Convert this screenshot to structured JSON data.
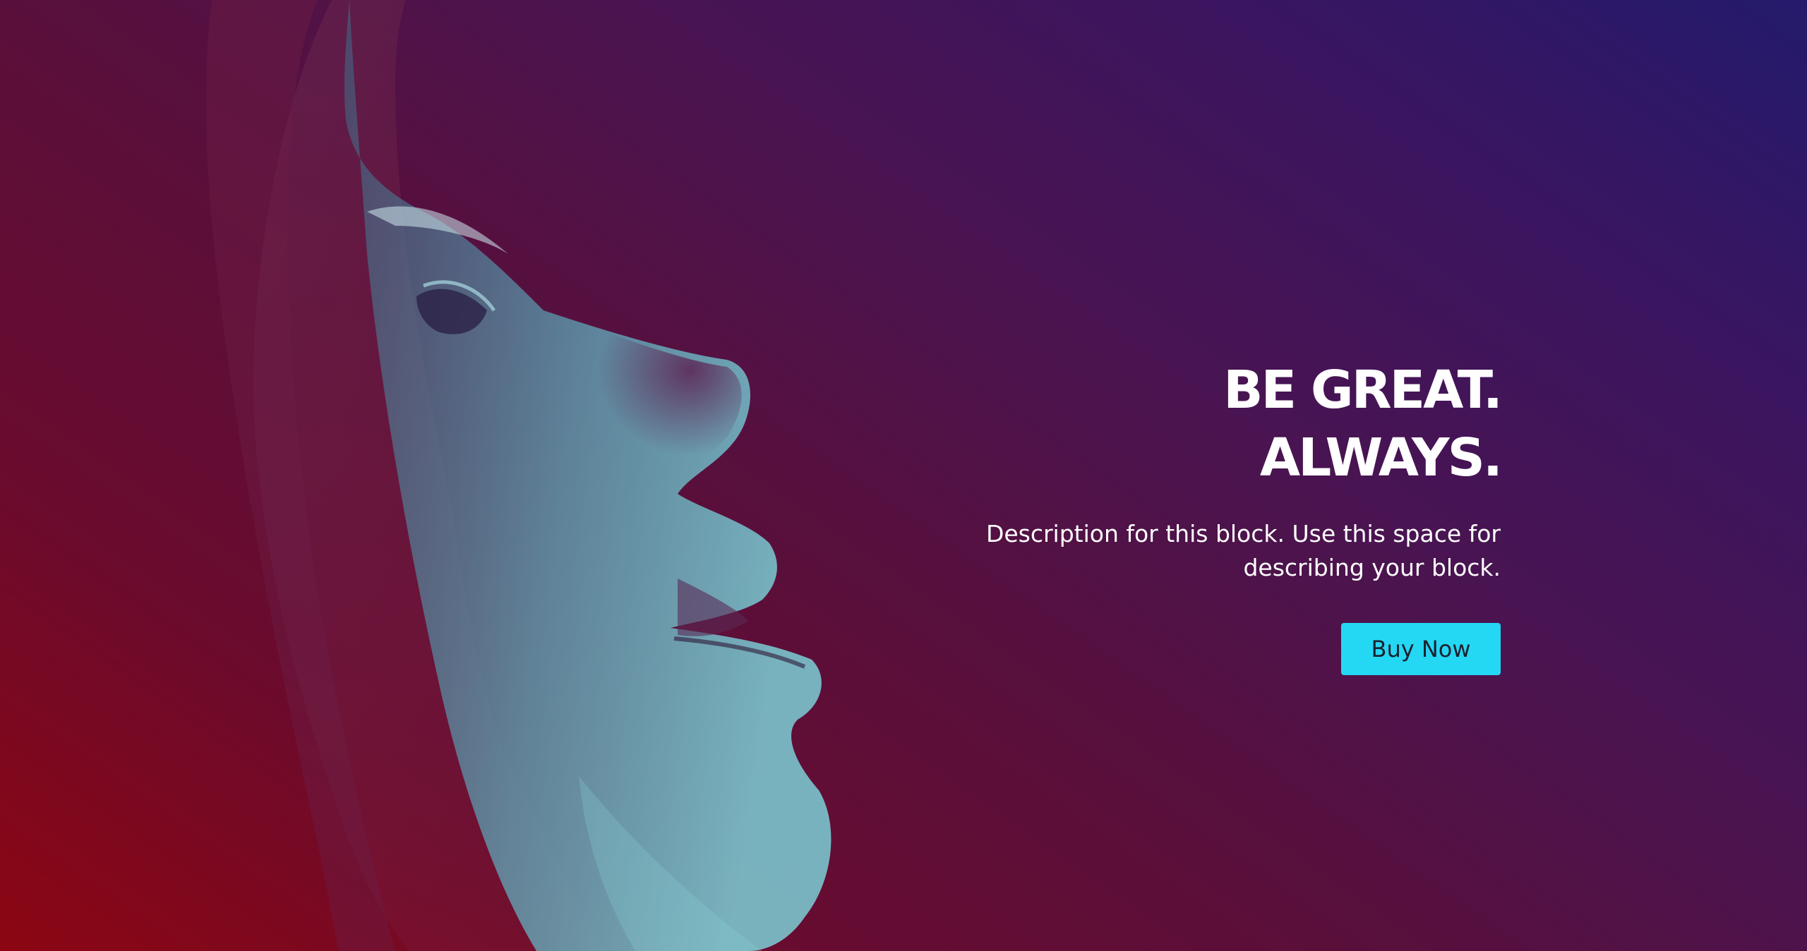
{
  "hero": {
    "headline_line1": "BE GREAT.",
    "headline_line2": "ALWAYS.",
    "description_line1": "Description for this block. Use this space for",
    "description_line2": "describing your block.",
    "button_label": "Buy Now"
  },
  "colors": {
    "gradient_start": "#8c0612",
    "gradient_mid": "#5a0f3a",
    "gradient_end": "#241a6c",
    "button_bg": "#24d8f4",
    "button_text": "#1b2030",
    "headline_text": "#ffffff",
    "portrait_tint": "#5fbfc9"
  },
  "image": {
    "subject": "profile-portrait-image"
  }
}
